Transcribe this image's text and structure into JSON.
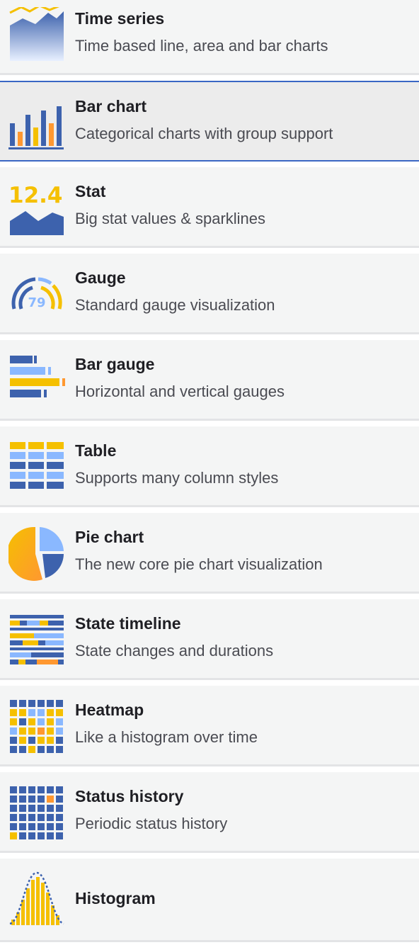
{
  "visualizations": [
    {
      "id": "time-series",
      "title": "Time series",
      "description": "Time based line, area and bar charts",
      "icon": "time-series-icon",
      "selected": false
    },
    {
      "id": "bar-chart",
      "title": "Bar chart",
      "description": "Categorical charts with group support",
      "icon": "bar-chart-icon",
      "selected": true
    },
    {
      "id": "stat",
      "title": "Stat",
      "description": "Big stat values & sparklines",
      "icon": "stat-icon",
      "icon_text": "12.4",
      "selected": false
    },
    {
      "id": "gauge",
      "title": "Gauge",
      "description": "Standard gauge visualization",
      "icon": "gauge-icon",
      "icon_text": "79",
      "selected": false
    },
    {
      "id": "bar-gauge",
      "title": "Bar gauge",
      "description": "Horizontal and vertical gauges",
      "icon": "bar-gauge-icon",
      "selected": false
    },
    {
      "id": "table",
      "title": "Table",
      "description": "Supports many column styles",
      "icon": "table-icon",
      "selected": false
    },
    {
      "id": "pie-chart",
      "title": "Pie chart",
      "description": "The new core pie chart visualization",
      "icon": "pie-chart-icon",
      "selected": false
    },
    {
      "id": "state-timeline",
      "title": "State timeline",
      "description": "State changes and durations",
      "icon": "state-timeline-icon",
      "selected": false
    },
    {
      "id": "heatmap",
      "title": "Heatmap",
      "description": "Like a histogram over time",
      "icon": "heatmap-icon",
      "selected": false
    },
    {
      "id": "status-history",
      "title": "Status history",
      "description": "Periodic status history",
      "icon": "status-history-icon",
      "selected": false
    },
    {
      "id": "histogram",
      "title": "Histogram",
      "description": "",
      "icon": "histogram-icon",
      "selected": false
    }
  ],
  "colors": {
    "card_bg": "#f4f5f5",
    "card_selected_bg": "#ececec",
    "selected_border": "#3a67c4",
    "blue_dark": "#3d62ad",
    "blue_light": "#8ab8ff",
    "yellow": "#f5c000",
    "orange": "#ff9830"
  }
}
